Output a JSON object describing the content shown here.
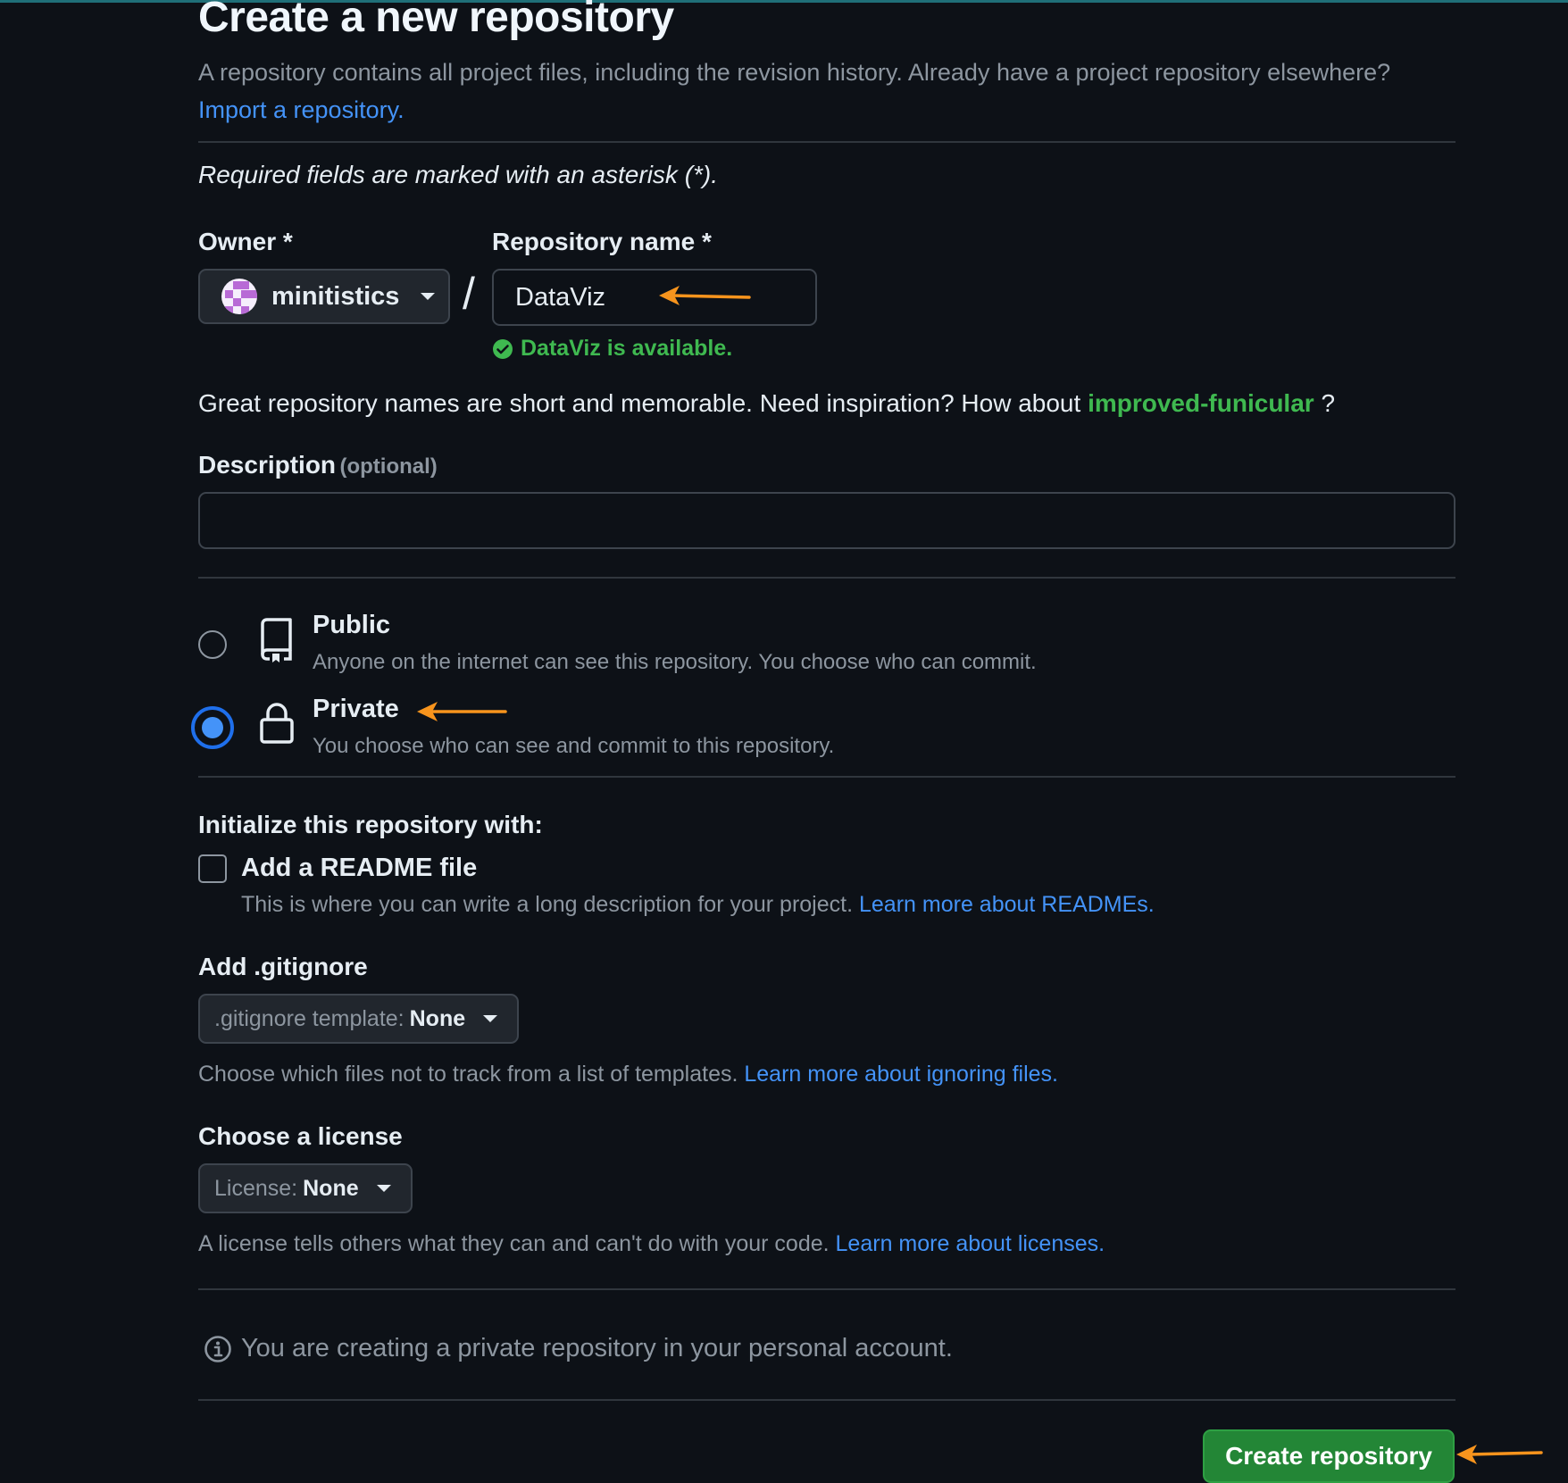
{
  "page": {
    "title": "Create a new repository",
    "intro_text": "A repository contains all project files, including the revision history. Already have a project repository elsewhere?",
    "import_link": "Import a repository.",
    "required_note": "Required fields are marked with an asterisk (*)."
  },
  "owner": {
    "label": "Owner *",
    "value": "minitistics",
    "icon": "caret-down-icon"
  },
  "separator": "/",
  "repo_name": {
    "label": "Repository name *",
    "value": "DataViz",
    "availability": "DataViz is available."
  },
  "suggestion": {
    "text": "Great repository names are short and memorable. Need inspiration? How about",
    "name": "improved-funicular",
    "suffix": "?"
  },
  "description": {
    "label": "Description",
    "optional": "(optional)",
    "value": ""
  },
  "visibility": {
    "selected": "private",
    "public": {
      "title": "Public",
      "desc": "Anyone on the internet can see this repository. You choose who can commit."
    },
    "private": {
      "title": "Private",
      "desc": "You choose who can see and commit to this repository."
    }
  },
  "initialize": {
    "heading": "Initialize this repository with:",
    "readme_label": "Add a README file",
    "readme_checked": false,
    "readme_desc": "This is where you can write a long description for your project.",
    "readme_link": "Learn more about READMEs."
  },
  "gitignore": {
    "heading": "Add .gitignore",
    "key": ".gitignore template:",
    "value": "None",
    "desc": "Choose which files not to track from a list of templates.",
    "link": "Learn more about ignoring files."
  },
  "license": {
    "heading": "Choose a license",
    "key": "License:",
    "value": "None",
    "desc": "A license tells others what they can and can't do with your code.",
    "link": "Learn more about licenses."
  },
  "notice": "You are creating a private repository in your personal account.",
  "create_button": "Create repository",
  "colors": {
    "background": "#0d1117",
    "link": "#4493f8",
    "success": "#3fb950",
    "primary_button": "#238636",
    "annotation_arrow": "#f7941d"
  }
}
